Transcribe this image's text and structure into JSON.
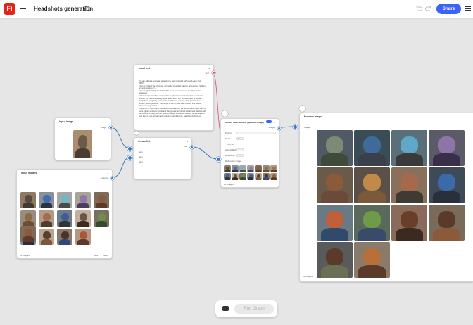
{
  "topbar": {
    "app_title": "Headshots generation",
    "share_label": "Share"
  },
  "nodes": {
    "input_text": {
      "title": "Input text",
      "badge": "Text",
      "paragraphs": [
        "You are editing a corporate Headshot by harmonizing it with a tech-page style.",
        "INPUT",
        "- Item 1: “{{disc}}” (a reference, not the for Input style framing, accessories, lighting, and expression etc.)",
        "- Item 2: “{{LOCATE}}” headshot. This is the persons’ picture identity must be preserved.",
        "GOAL: Output an edited version of Item 2 that looks like it was shot in the same session, by the same photographer, at the same set, as the subject by as Item 1. Match Item 1’s lighting, color grade, background, framing, body posture, head position, and expression. The people in item 2 must wear clothing that fits the reference image item 1.",
        "Output item 2 such that it should be reproduced but the person there match with the same lighting and color grade and background and then it should look identical with the references being one set, different people in different clothing. All any features from item 2 must remain intact including age, skin tone, hairstyle, clothing, etc."
      ]
    },
    "input_image": {
      "title": "Input image",
      "badge": "Image"
    },
    "input_images": {
      "title": "Input images",
      "badge": "Images",
      "count_label": "14 images",
      "add_label": "Add",
      "more_label": "More"
    },
    "create_list": {
      "title": "Create list",
      "badge": "List",
      "items": [
        "Item",
        "Item",
        "Item"
      ]
    },
    "nano_banana": {
      "title": "Gemini Nano Banana (generate image)",
      "badge": "Image",
      "fields": [
        "Prompt",
        "Seed",
        "Aspect Ratio",
        "Resolution",
        "Reference image"
      ],
      "seed_value": "1",
      "upscale_label": "Upscale",
      "count_label": "14 images"
    },
    "preview_image": {
      "title": "Preview image",
      "badge": "Image",
      "count_label": "14 images"
    }
  },
  "runbar": {
    "run_label": "Run Graph"
  },
  "colors": {
    "brand": "#e1251b",
    "accent": "#3b63fb",
    "wire": "#3c79bf",
    "wire_pink": "#d84a8a"
  },
  "icons": [
    "firefly-logo",
    "hamburger-icon",
    "cloud-icon",
    "undo-icon",
    "redo-icon",
    "apps-grid-icon",
    "chevron-down-icon",
    "run-icon",
    "settings-gear-icon"
  ]
}
